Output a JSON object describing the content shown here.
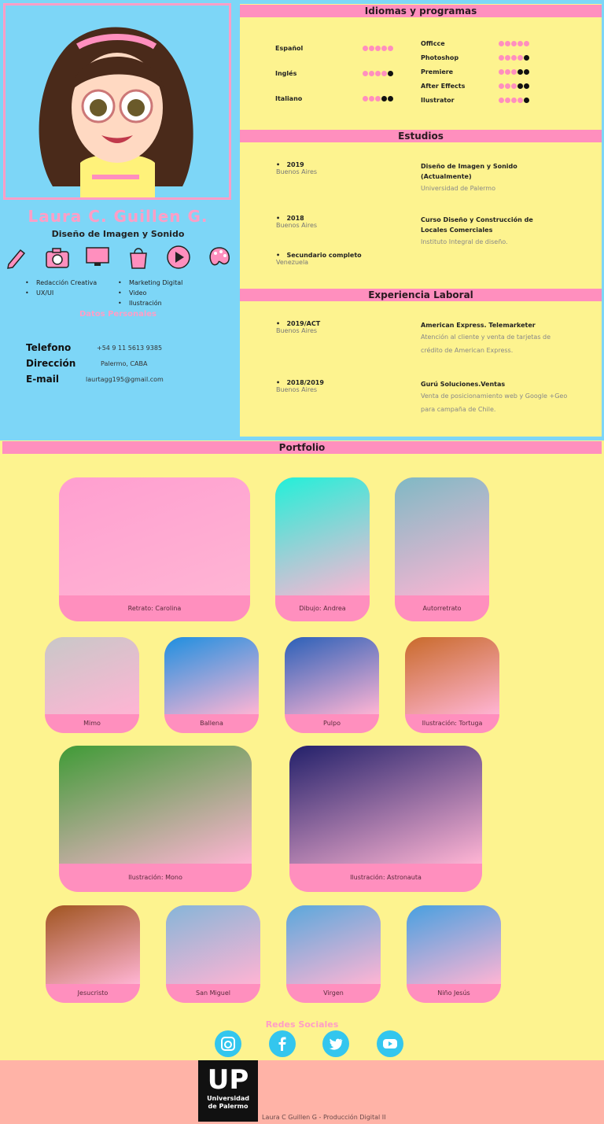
{
  "profile": {
    "name": "Laura C. Guillen G.",
    "subtitle": "Diseño de Imagen y Sonido",
    "skills_left": [
      "Redacción Creativa",
      "UX/UI"
    ],
    "skills_right": [
      "Marketing Digital",
      "Video",
      "Ilustración"
    ],
    "personal_title": "Datos Personales",
    "personal": [
      {
        "label": "Telefono",
        "value": "+54 9 11 5613 9385"
      },
      {
        "label": "Dirección",
        "value": "Palermo, CABA"
      },
      {
        "label": "E-mail",
        "value": "laurtagg195@gmail.com"
      }
    ],
    "skill_icons": [
      "pencil-icon",
      "camera-icon",
      "monitor-icon",
      "shopping-bag-icon",
      "play-icon",
      "palette-icon"
    ]
  },
  "languages": {
    "title": "Idiomas y programas",
    "left": [
      {
        "name": "Español",
        "level": 5
      },
      {
        "name": "Inglés",
        "level": 4
      },
      {
        "name": "Italiano",
        "level": 3
      }
    ],
    "right": [
      {
        "name": "Officce",
        "level": 5
      },
      {
        "name": "Photoshop",
        "level": 4
      },
      {
        "name": "Premiere",
        "level": 3
      },
      {
        "name": "After Effects",
        "level": 3
      },
      {
        "name": "Ilustrator",
        "level": 4
      }
    ]
  },
  "studies": {
    "title": "Estudios",
    "items": [
      {
        "year": "2019",
        "place": "Buenos Aires",
        "title": "Diseño de Imagen y Sonido (Actualmente)",
        "inst": "Universidad de Palermo"
      },
      {
        "year": "2018",
        "place": "Buenos Aires",
        "title": "Curso Diseño y Construcción de Locales Comerciales",
        "inst": "Instituto Integral de diseño."
      },
      {
        "year": "Secundario completo",
        "place": "Venezuela",
        "title": "",
        "inst": ""
      }
    ]
  },
  "experience": {
    "title": "Experiencia Laboral",
    "items": [
      {
        "year": "2019/ACT",
        "place": "Buenos Aires",
        "title": "American Express. Telemarketer",
        "desc": "Atención al cliente y venta de tarjetas de crédito de American Express."
      },
      {
        "year": "2018/2019",
        "place": "Buenos Aires",
        "title": "Gurú Soluciones.Ventas",
        "desc": "Venta de posicionamiento web y Google +Geo para campaña de Chile."
      }
    ]
  },
  "portfolio": {
    "title": "Portfolio",
    "items": [
      {
        "caption": "Retrato: Carolina",
        "bg": "#ff9fd0"
      },
      {
        "caption": "Dibujo: Andrea",
        "bg": "#22f0d8"
      },
      {
        "caption": "Autorretrato",
        "bg": "#7fb9c4"
      },
      {
        "caption": "Mimo",
        "bg": "#c8c8c8"
      },
      {
        "caption": "Ballena",
        "bg": "#1e8fe0"
      },
      {
        "caption": "Pulpo",
        "bg": "#2a60b8"
      },
      {
        "caption": "Ilustración: Tortuga",
        "bg": "#c96a2a"
      },
      {
        "caption": "Ilustración: Mono",
        "bg": "#3f9b36"
      },
      {
        "caption": "Ilustración: Astronauta",
        "bg": "#22206a"
      },
      {
        "caption": "Jesucristo",
        "bg": "#a0541f"
      },
      {
        "caption": "San Miguel",
        "bg": "#86b5d8"
      },
      {
        "caption": "Virgen",
        "bg": "#5aa8dc"
      },
      {
        "caption": "Niño Jesús",
        "bg": "#48a0e0"
      }
    ]
  },
  "social": {
    "title": "Redes Sociales",
    "icons": [
      "instagram-icon",
      "facebook-icon",
      "twitter-icon",
      "youtube-icon"
    ]
  },
  "footer": {
    "logo_big": "UP",
    "logo_line1": "Universidad",
    "logo_line2": "de Palermo",
    "credit": "Laura C Guillen G - Producción Digital II"
  },
  "colors": {
    "pink": "#ff8fbe",
    "yellow": "#fdf38f",
    "blue": "#7dd6f7",
    "footer": "#ffb3a7"
  }
}
